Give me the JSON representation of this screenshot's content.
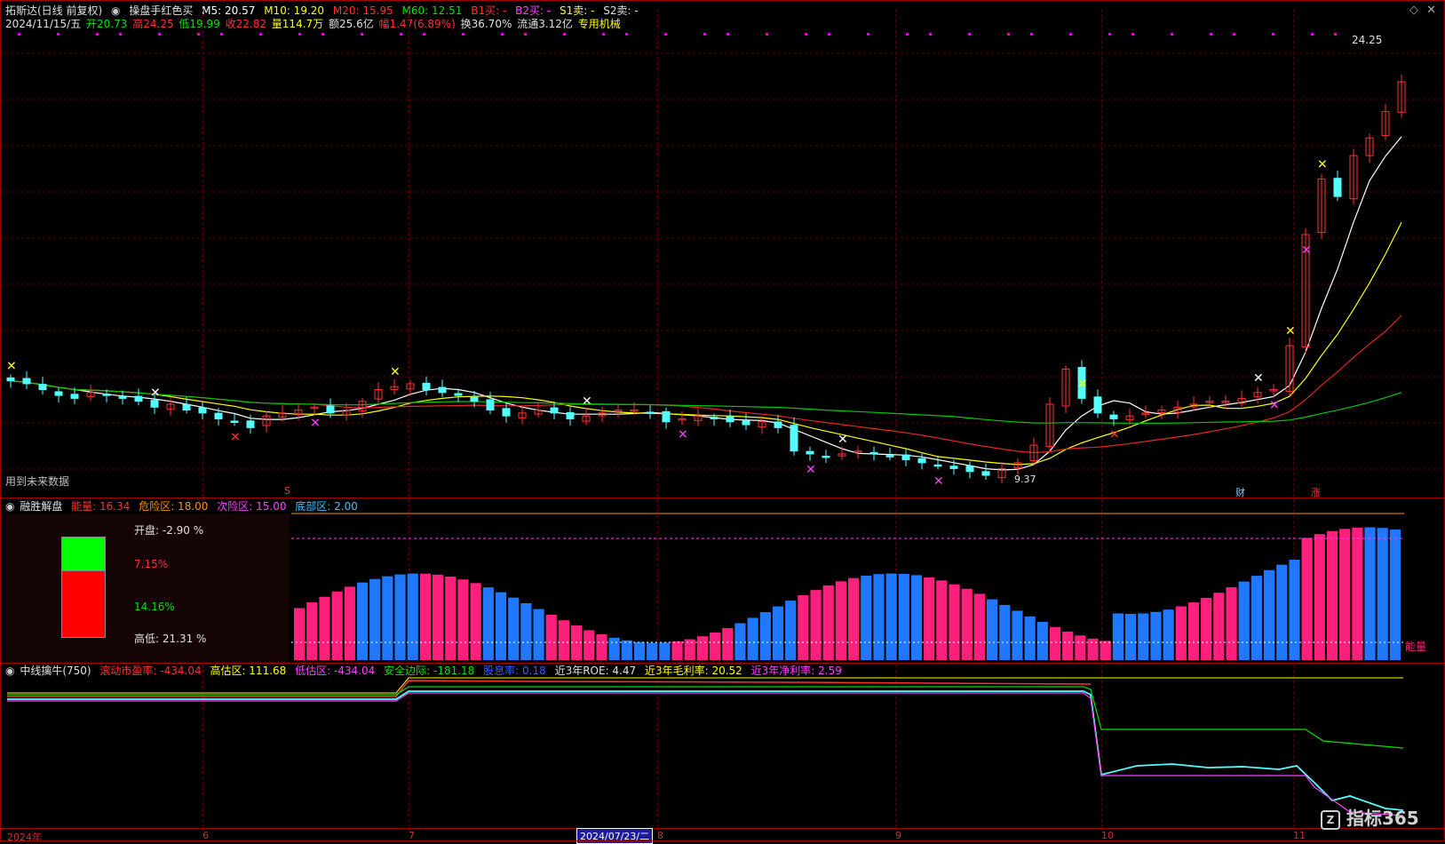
{
  "header": {
    "stock_name": "拓斯达(日线 前复权)",
    "indicator_name": "操盘手红色买",
    "m5": "M5: 20.57",
    "m10": "M10: 19.20",
    "m20": "M20: 15.95",
    "m60": "M60: 12.51",
    "b1": "B1买: -",
    "b2": "B2买: -",
    "s1": "S1卖: -",
    "s2": "S2卖: -"
  },
  "quote": {
    "date": "2024/11/15/五",
    "open": "开20.73",
    "high": "高24.25",
    "low": "低19.99",
    "close": "收22.82",
    "volume": "量114.7万",
    "amount": "额25.6亿",
    "change": "幅1.47(6.89%)",
    "turnover": "换36.70%",
    "float_cap": "流通3.12亿",
    "sector": "专用机械"
  },
  "main_chart": {
    "future_data_note": "用到未来数据",
    "max_price_label": "24.25",
    "min_price_label": "9.37",
    "marker_s": "S",
    "marker_cai": "财",
    "marker_zhang": "涨"
  },
  "panel2": {
    "title": "融胜解盘",
    "energy": "能量: 16.34",
    "danger": "危险区: 18.00",
    "risk": "次险区: 15.00",
    "bottom": "底部区: 2.00",
    "open_label": "开盘: -2.90 %",
    "red_pct": "7.15%",
    "green_pct": "14.16%",
    "high_low": "高低: 21.31 %",
    "energy_tag": "能量"
  },
  "panel3": {
    "title": "中线擒牛(750)",
    "pe": "滚动市盈率: -434.04",
    "high_est": "高估区: 111.68",
    "low_est": "低估区: -434.04",
    "safety": "安全边际: -181.18",
    "dividend": "股息率: 0.18",
    "roe": "近3年ROE: 4.47",
    "gross": "近3年毛利率: 20.52",
    "net": "近3年净利率: 2.59"
  },
  "x_axis": {
    "labels": [
      "2024年",
      "6",
      "7",
      "8",
      "9",
      "10",
      "11"
    ],
    "cursor_date": "2024/07/23/二"
  },
  "watermark": "指标365",
  "colors": {
    "up": "#ff3232",
    "down": "#54ffff",
    "ma5": "#ffffff",
    "ma10": "#ffff00",
    "ma20": "#e0282a",
    "ma60": "#00c800",
    "bar_pink": "#ff1f7c",
    "bar_blue": "#1f78ff"
  },
  "chart_data": {
    "type": "candlestick",
    "y_range": [
      9.37,
      24.25
    ],
    "close_series_approx": [
      12.6,
      12.5,
      12.3,
      12.1,
      12.0,
      12.2,
      12.1,
      12.0,
      11.9,
      11.7,
      11.8,
      11.6,
      11.5,
      11.3,
      11.2,
      11.0,
      11.4,
      11.5,
      11.6,
      11.7,
      11.5,
      11.6,
      11.9,
      12.3,
      12.4,
      12.5,
      12.3,
      12.2,
      12.1,
      11.9,
      11.6,
      11.4,
      11.5,
      11.6,
      11.5,
      11.3,
      11.4,
      11.5,
      11.6,
      11.6,
      11.5,
      11.2,
      11.3,
      11.4,
      11.3,
      11.2,
      11.1,
      11.2,
      11.0,
      10.2,
      10.1,
      10.0,
      10.1,
      10.2,
      10.1,
      10.0,
      9.9,
      9.8,
      9.7,
      9.6,
      9.5,
      9.37,
      9.6,
      9.8,
      10.4,
      11.8,
      13.0,
      12.0,
      11.5,
      11.3,
      11.4,
      11.5,
      11.6,
      11.7,
      11.8,
      11.9,
      11.9,
      12.0,
      12.2,
      12.3,
      13.8,
      17.6,
      19.5,
      18.9,
      20.3,
      20.9,
      21.8,
      22.82
    ]
  }
}
